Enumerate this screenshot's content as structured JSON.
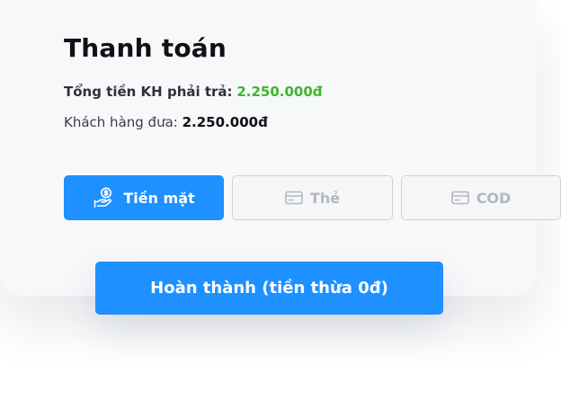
{
  "payment": {
    "title": "Thanh toán",
    "total_label": "Tổng tiền KH phải trả:",
    "total_value": "2.250.000đ",
    "paid_label": "Khách hàng đưa:",
    "paid_value": "2.250.000đ"
  },
  "methods": [
    {
      "label": "Tiền mặt",
      "icon": "cash-hand-icon",
      "selected": true
    },
    {
      "label": "Thẻ",
      "icon": "credit-card-icon",
      "selected": false
    },
    {
      "label": "COD",
      "icon": "credit-card-icon",
      "selected": false
    }
  ],
  "complete_button": {
    "label": "Hoàn thành (tiền thừa 0đ)"
  },
  "colors": {
    "accent": "#1E90FF",
    "amount_green": "#3CB62C",
    "card_bg": "#F7F8FA",
    "disabled_text": "#B4B8BE"
  }
}
